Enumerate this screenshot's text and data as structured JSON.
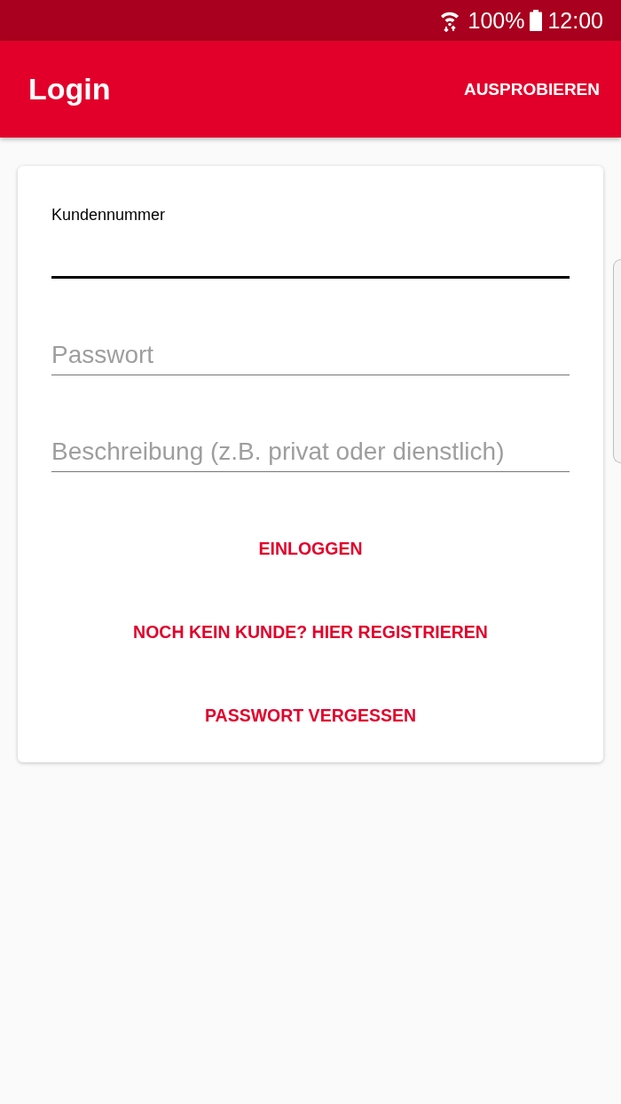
{
  "status_bar": {
    "battery": "100%",
    "time": "12:00"
  },
  "app_bar": {
    "title": "Login",
    "action": "AUSPROBIEREN"
  },
  "fields": [
    {
      "label": "Kundennummer",
      "focused": true
    },
    {
      "placeholder": "Passwort",
      "focused": false
    },
    {
      "placeholder": "Beschreibung (z.B. privat oder dienstlich)",
      "focused": false
    }
  ],
  "buttons": [
    "EINLOGGEN",
    "NOCH KEIN KUNDE? HIER REGISTRIEREN",
    "PASSWORT VERGESSEN"
  ]
}
